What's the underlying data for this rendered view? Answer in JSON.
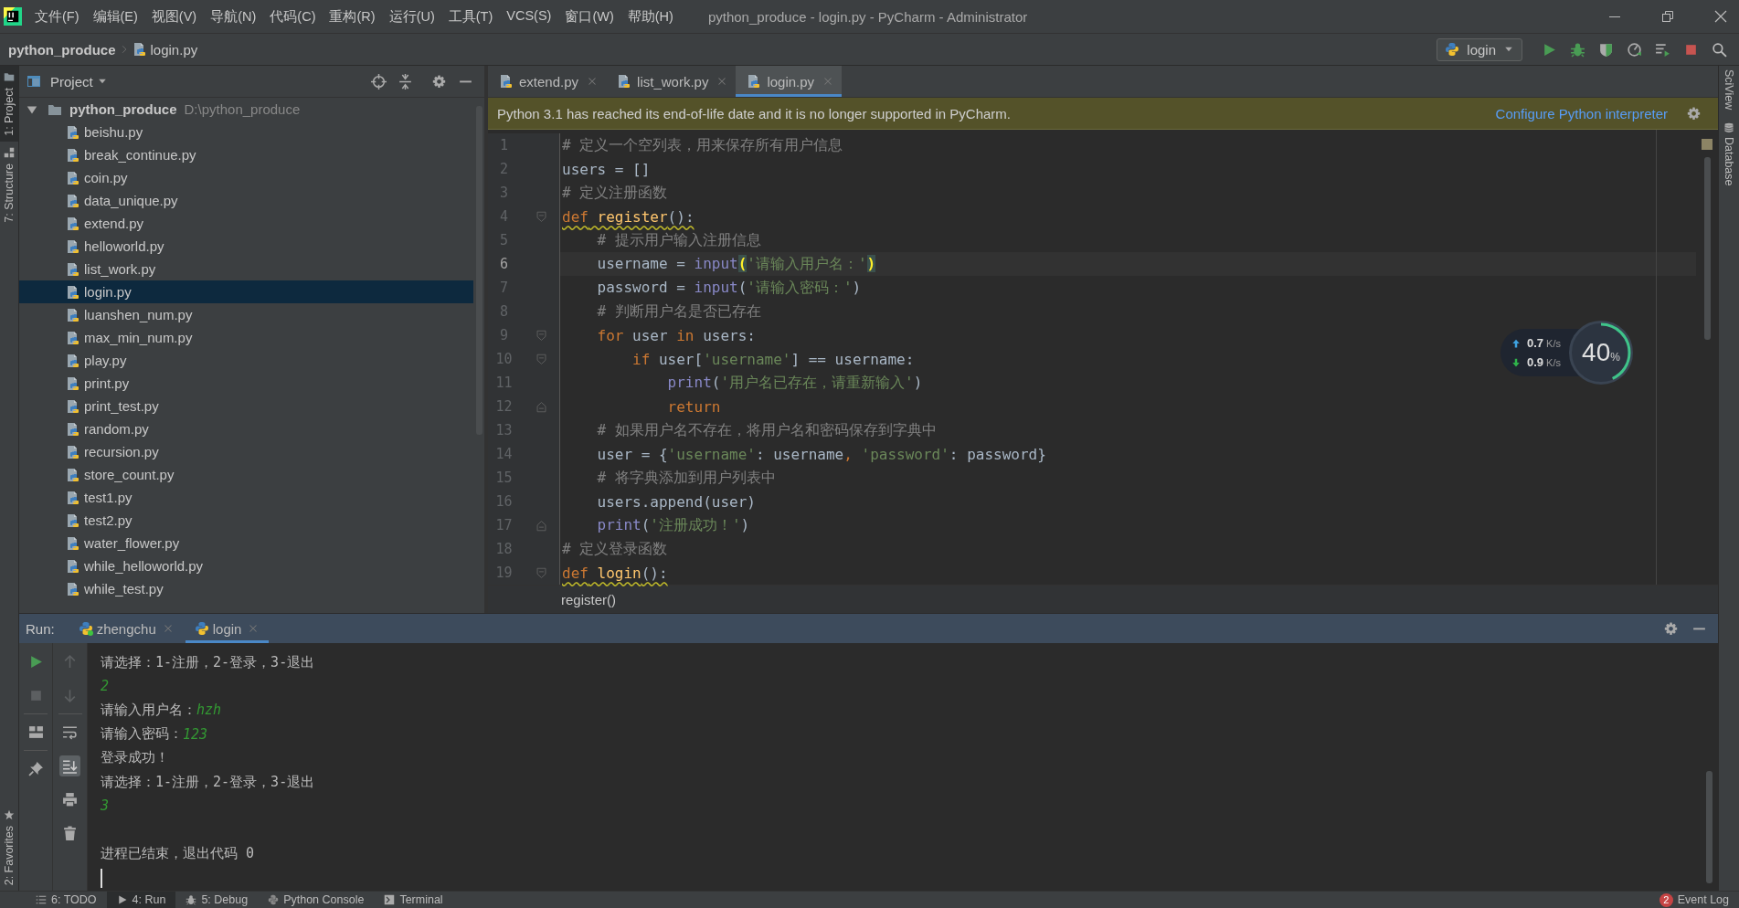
{
  "window": {
    "title": "python_produce - login.py - PyCharm - Administrator"
  },
  "menu": [
    "文件(F)",
    "编辑(E)",
    "视图(V)",
    "导航(N)",
    "代码(C)",
    "重构(R)",
    "运行(U)",
    "工具(T)",
    "VCS(S)",
    "窗口(W)",
    "帮助(H)"
  ],
  "breadcrumb": {
    "project": "python_produce",
    "file": "login.py"
  },
  "run_config": {
    "label": "login"
  },
  "left_stripe": {
    "top": [
      {
        "label": "1: Project",
        "selected": true
      },
      {
        "label": "7: Structure",
        "selected": false
      }
    ],
    "bottom": [
      {
        "label": "2: Favorites",
        "selected": false
      }
    ]
  },
  "right_stripe": [
    {
      "label": "SciView"
    },
    {
      "label": "Database"
    }
  ],
  "project_panel": {
    "title": "Project",
    "root": {
      "name": "python_produce",
      "path": "D:\\python_produce",
      "expanded": true,
      "children": [
        {
          "name": "beishu.py",
          "selected": false
        },
        {
          "name": "break_continue.py",
          "selected": false
        },
        {
          "name": "coin.py",
          "selected": false
        },
        {
          "name": "data_unique.py",
          "selected": false
        },
        {
          "name": "extend.py",
          "selected": false
        },
        {
          "name": "helloworld.py",
          "selected": false
        },
        {
          "name": "list_work.py",
          "selected": false
        },
        {
          "name": "login.py",
          "selected": true
        },
        {
          "name": "luanshen_num.py",
          "selected": false
        },
        {
          "name": "max_min_num.py",
          "selected": false
        },
        {
          "name": "play.py",
          "selected": false
        },
        {
          "name": "print.py",
          "selected": false
        },
        {
          "name": "print_test.py",
          "selected": false
        },
        {
          "name": "random.py",
          "selected": false
        },
        {
          "name": "recursion.py",
          "selected": false
        },
        {
          "name": "store_count.py",
          "selected": false
        },
        {
          "name": "test1.py",
          "selected": false
        },
        {
          "name": "test2.py",
          "selected": false
        },
        {
          "name": "water_flower.py",
          "selected": false
        },
        {
          "name": "while_helloworld.py",
          "selected": false
        },
        {
          "name": "while_test.py",
          "selected": false
        }
      ]
    }
  },
  "editor_tabs": [
    {
      "label": "extend.py",
      "selected": false
    },
    {
      "label": "list_work.py",
      "selected": false
    },
    {
      "label": "login.py",
      "selected": true
    }
  ],
  "banner": {
    "message": "Python 3.1 has reached its end-of-life date and it is no longer supported in PyCharm.",
    "link": "Configure Python interpreter"
  },
  "code": {
    "lines": [
      {
        "number": "1",
        "tokens": [
          {
            "text": "# 定义一个空列表，用来保存所有用户信息",
            "kind": "comment"
          }
        ]
      },
      {
        "number": "2",
        "tokens": [
          {
            "text": "users = []",
            "kind": "plain"
          }
        ]
      },
      {
        "number": "3",
        "tokens": [
          {
            "text": "# 定义注册函数",
            "kind": "comment"
          }
        ]
      },
      {
        "number": "4",
        "fold_start": true,
        "warning": true,
        "tokens": [
          {
            "text": "def",
            "kind": "keyword"
          },
          {
            "text": " register",
            "kind": "function"
          },
          {
            "text": "():",
            "kind": "plain"
          }
        ]
      },
      {
        "number": "5",
        "tokens": [
          {
            "text": "    # 提示用户输入注册信息",
            "kind": "comment"
          }
        ]
      },
      {
        "number": "6",
        "current": true,
        "tokens": [
          {
            "text": "    username = ",
            "kind": "plain"
          },
          {
            "text": "input",
            "kind": "builtin"
          },
          {
            "text": "(",
            "kind": "brace"
          },
          {
            "text": "'请输入用户名：'",
            "kind": "string"
          },
          {
            "text": ")",
            "kind": "brace"
          }
        ]
      },
      {
        "number": "7",
        "tokens": [
          {
            "text": "    password = ",
            "kind": "plain"
          },
          {
            "text": "input",
            "kind": "builtin"
          },
          {
            "text": "(",
            "kind": "plain"
          },
          {
            "text": "'请输入密码：'",
            "kind": "string"
          },
          {
            "text": ")",
            "kind": "plain"
          }
        ]
      },
      {
        "number": "8",
        "tokens": [
          {
            "text": "    # 判断用户名是否已存在",
            "kind": "comment"
          }
        ]
      },
      {
        "number": "9",
        "fold_start": true,
        "tokens": [
          {
            "text": "    for",
            "kind": "keyword"
          },
          {
            "text": " user ",
            "kind": "plain"
          },
          {
            "text": "in",
            "kind": "keyword"
          },
          {
            "text": " users:",
            "kind": "plain"
          }
        ]
      },
      {
        "number": "10",
        "fold_start": true,
        "tokens": [
          {
            "text": "        if",
            "kind": "keyword"
          },
          {
            "text": " user[",
            "kind": "plain"
          },
          {
            "text": "'username'",
            "kind": "string"
          },
          {
            "text": "] == username:",
            "kind": "plain"
          }
        ]
      },
      {
        "number": "11",
        "tokens": [
          {
            "text": "            print",
            "kind": "builtin"
          },
          {
            "text": "(",
            "kind": "plain"
          },
          {
            "text": "'用户名已存在，请重新输入'",
            "kind": "string"
          },
          {
            "text": ")",
            "kind": "plain"
          }
        ]
      },
      {
        "number": "12",
        "fold_end": true,
        "tokens": [
          {
            "text": "            return",
            "kind": "keyword"
          }
        ]
      },
      {
        "number": "13",
        "tokens": [
          {
            "text": "    # 如果用户名不存在，将用户名和密码保存到字典中",
            "kind": "comment"
          }
        ]
      },
      {
        "number": "14",
        "tokens": [
          {
            "text": "    user = {",
            "kind": "plain"
          },
          {
            "text": "'username'",
            "kind": "string"
          },
          {
            "text": ": username",
            "kind": "plain"
          },
          {
            "text": ",",
            "kind": "keyword"
          },
          {
            "text": " 'password'",
            "kind": "string"
          },
          {
            "text": ": password}",
            "kind": "plain"
          }
        ]
      },
      {
        "number": "15",
        "tokens": [
          {
            "text": "    # 将字典添加到用户列表中",
            "kind": "comment"
          }
        ]
      },
      {
        "number": "16",
        "tokens": [
          {
            "text": "    users.append(user)",
            "kind": "plain"
          }
        ]
      },
      {
        "number": "17",
        "fold_end": true,
        "tokens": [
          {
            "text": "    print",
            "kind": "builtin"
          },
          {
            "text": "(",
            "kind": "plain"
          },
          {
            "text": "'注册成功！'",
            "kind": "string"
          },
          {
            "text": ")",
            "kind": "plain"
          }
        ]
      },
      {
        "number": "18",
        "tokens": [
          {
            "text": "# 定义登录函数",
            "kind": "comment"
          }
        ]
      },
      {
        "number": "19",
        "fold_start": true,
        "warning": true,
        "tokens": [
          {
            "text": "def",
            "kind": "keyword"
          },
          {
            "text": " login",
            "kind": "function"
          },
          {
            "text": "():",
            "kind": "plain"
          }
        ]
      }
    ],
    "context": "register()"
  },
  "net_monitor": {
    "upload": {
      "value": "0.7",
      "unit": "K/s"
    },
    "download": {
      "value": "0.9",
      "unit": "K/s"
    },
    "cpu": {
      "value": "40",
      "unit": "%"
    }
  },
  "run_panel": {
    "title": "Run:",
    "tabs": [
      {
        "label": "zhengchu",
        "selected": false,
        "running": true
      },
      {
        "label": "login",
        "selected": true,
        "running": false
      }
    ],
    "actions": [
      {
        "kind": "rerun",
        "disabled": false,
        "on": false
      },
      {
        "kind": "stop",
        "disabled": true,
        "on": false
      },
      {
        "kind": "layout",
        "disabled": false,
        "on": false
      },
      {
        "kind": "pin",
        "disabled": false,
        "on": false
      }
    ],
    "view_tools": [
      {
        "kind": "up",
        "disabled": true,
        "on": false
      },
      {
        "kind": "down",
        "disabled": true,
        "on": false
      },
      {
        "kind": "wrap",
        "disabled": false,
        "on": false
      },
      {
        "kind": "scroll-end",
        "disabled": false,
        "on": true
      },
      {
        "kind": "print",
        "disabled": false,
        "on": false
      },
      {
        "kind": "trash",
        "disabled": false,
        "on": false
      }
    ],
    "console": [
      {
        "parts": [
          {
            "text": "请选择：1-注册，2-登录，3-退出",
            "kind": "output"
          }
        ]
      },
      {
        "parts": [
          {
            "text": "2",
            "kind": "input"
          }
        ]
      },
      {
        "parts": [
          {
            "text": "请输入用户名：",
            "kind": "output"
          },
          {
            "text": "hzh",
            "kind": "input"
          }
        ]
      },
      {
        "parts": [
          {
            "text": "请输入密码：",
            "kind": "output"
          },
          {
            "text": "123",
            "kind": "input"
          }
        ]
      },
      {
        "parts": [
          {
            "text": "登录成功！",
            "kind": "output"
          }
        ]
      },
      {
        "parts": [
          {
            "text": "请选择：1-注册，2-登录，3-退出",
            "kind": "output"
          }
        ]
      },
      {
        "parts": [
          {
            "text": "3",
            "kind": "input"
          }
        ]
      },
      {
        "gap_before": true,
        "parts": [
          {
            "text": "进程已结束，退出代码 0",
            "kind": "output"
          }
        ]
      }
    ]
  },
  "tool_windows": [
    {
      "label": "6: TODO",
      "kind": "todo",
      "selected": false
    },
    {
      "label": "4: Run",
      "kind": "run",
      "selected": true
    },
    {
      "label": "5: Debug",
      "kind": "debug",
      "selected": false
    },
    {
      "label": "Python Console",
      "kind": "python",
      "selected": false
    },
    {
      "label": "Terminal",
      "kind": "terminal",
      "selected": false
    }
  ],
  "event_log": {
    "label": "Event Log",
    "count": "2"
  }
}
